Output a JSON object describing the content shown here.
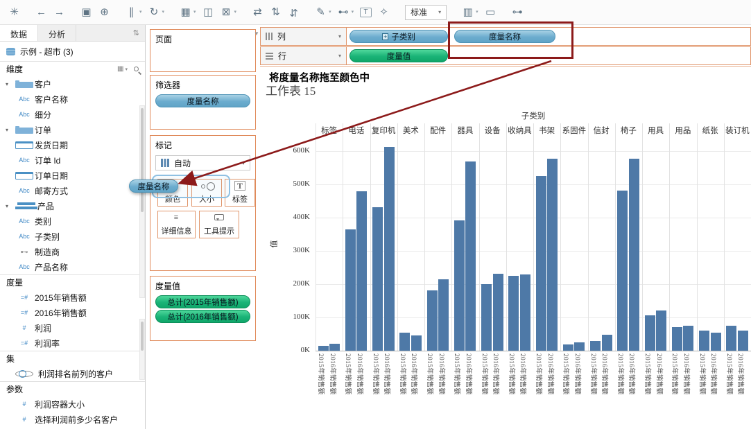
{
  "colors": {
    "bar_blue": "#4e79a7",
    "pill_dimension_teal": "#68abcd",
    "pill_measure_green": "#17b374",
    "annotation_red": "#8c1a1a",
    "highlight_border_orange": "#e08a5a"
  },
  "toolbar": {
    "items": [
      {
        "name": "tableau-logo",
        "glyph": "✳"
      },
      {
        "name": "undo",
        "glyph": "←",
        "gap": true
      },
      {
        "name": "redo",
        "glyph": "→"
      },
      {
        "name": "save",
        "glyph": "▣",
        "gap": true
      },
      {
        "name": "add-datasource",
        "glyph": "⊕"
      },
      {
        "name": "pause-updates",
        "glyph": "∥",
        "dropdown": true,
        "gap": true
      },
      {
        "name": "refresh",
        "glyph": "↻",
        "dropdown": true
      },
      {
        "name": "new-worksheet",
        "glyph": "▦",
        "dropdown": true,
        "gap": true
      },
      {
        "name": "duplicate-sheet",
        "glyph": "◫"
      },
      {
        "name": "clear-sheet",
        "glyph": "⊠",
        "dropdown": true
      },
      {
        "name": "swap-axes",
        "glyph": "⇄",
        "gap": true
      },
      {
        "name": "sort-ascending",
        "glyph": "⇅"
      },
      {
        "name": "sort-descending",
        "glyph": "⇅",
        "flip": true
      },
      {
        "name": "highlight",
        "glyph": "✎",
        "dropdown": true,
        "gap": true
      },
      {
        "name": "group-members",
        "glyph": "⊷",
        "dropdown": true
      },
      {
        "name": "text-label",
        "glyph": "T",
        "boxed": true
      },
      {
        "name": "fix-axes",
        "glyph": "✧"
      },
      {
        "name": "fit",
        "type": "select",
        "label": "标准",
        "dropdown": true,
        "gap": true
      },
      {
        "name": "show-mark-labels",
        "glyph": "▥",
        "dropdown": true,
        "gap": true
      },
      {
        "name": "presentation-mode",
        "glyph": "▭"
      },
      {
        "name": "share",
        "glyph": "⊶",
        "gap": true
      }
    ]
  },
  "left_panel": {
    "tabs": [
      {
        "label": "数据",
        "active": true
      },
      {
        "label": "分析",
        "active": false
      }
    ],
    "datasource": {
      "label": "示例 - 超市 (3)"
    },
    "dimensions": {
      "title": "维度",
      "items": [
        {
          "icon": "folder",
          "label": "客户",
          "level": 0,
          "caret": true
        },
        {
          "icon": "abc",
          "label": "客户名称",
          "level": 1
        },
        {
          "icon": "abc",
          "label": "细分",
          "level": 1
        },
        {
          "icon": "folder",
          "label": "订单",
          "level": 0,
          "caret": true
        },
        {
          "icon": "calendar",
          "label": "发货日期",
          "level": 1
        },
        {
          "icon": "abc",
          "label": "订单 Id",
          "level": 1
        },
        {
          "icon": "calendar",
          "label": "订单日期",
          "level": 1
        },
        {
          "icon": "abc",
          "label": "邮寄方式",
          "level": 1
        },
        {
          "icon": "hierarchy",
          "label": "产品",
          "level": 0,
          "caret": true
        },
        {
          "icon": "abc",
          "label": "类别",
          "level": 1
        },
        {
          "icon": "abc",
          "label": "子类别",
          "level": 1
        },
        {
          "icon": "paperclip",
          "label": "制造商",
          "level": 1
        },
        {
          "icon": "abc",
          "label": "产品名称",
          "level": 1
        }
      ]
    },
    "measures": {
      "title": "度量",
      "items": [
        {
          "icon": "calc",
          "label": "2015年销售额"
        },
        {
          "icon": "calc",
          "label": "2016年销售额"
        },
        {
          "icon": "number",
          "label": "利润"
        },
        {
          "icon": "calc",
          "label": "利润率"
        }
      ]
    },
    "sets": {
      "title": "集",
      "items": [
        {
          "icon": "venn",
          "label": "利润排名前列的客户"
        }
      ]
    },
    "parameters": {
      "title": "参数",
      "items": [
        {
          "icon": "number",
          "label": "利润容器大小"
        },
        {
          "icon": "number",
          "label": "选择利润前多少名客户"
        }
      ]
    }
  },
  "cards": {
    "pages": {
      "title": "页面"
    },
    "filters": {
      "title": "筛选器",
      "pills": [
        {
          "label": "度量名称",
          "type": "dimension"
        }
      ]
    },
    "marks": {
      "title": "标记",
      "type_selector": {
        "label": "自动"
      },
      "buttons": [
        {
          "icon": "color",
          "label": "颜色"
        },
        {
          "icon": "size",
          "label": "大小"
        },
        {
          "icon": "label",
          "label": "标签"
        },
        {
          "icon": "detail",
          "label": "详细信息"
        },
        {
          "icon": "tooltip",
          "label": "工具提示"
        }
      ]
    },
    "measure_values": {
      "title": "度量值",
      "pills": [
        {
          "label": "总计(2015年销售额)",
          "type": "measure"
        },
        {
          "label": "总计(2016年销售额)",
          "type": "measure"
        }
      ]
    },
    "drag_pill": {
      "label": "度量名称"
    }
  },
  "shelves": {
    "columns": {
      "label": "列",
      "pills": [
        {
          "label": "子类别",
          "type": "dimension",
          "prefix": "+"
        },
        {
          "label": "度量名称",
          "type": "dimension",
          "highlighted": true
        }
      ]
    },
    "rows": {
      "label": "行",
      "pills": [
        {
          "label": "度量值",
          "type": "measure"
        }
      ]
    }
  },
  "annotation": {
    "text": "将度量名称拖至颜色中"
  },
  "chart_data": {
    "type": "bar",
    "title": "工作表 15",
    "column_header": "子类别",
    "ylabel": "值",
    "yticks": [
      "0K",
      "100K",
      "200K",
      "300K",
      "400K",
      "500K",
      "600K"
    ],
    "ylim": [
      0,
      635
    ],
    "grid": true,
    "categories": [
      "标签",
      "电话",
      "复印机",
      "美术",
      "配件",
      "器具",
      "设备",
      "收纳具",
      "书架",
      "系固件",
      "信封",
      "椅子",
      "用具",
      "用品",
      "纸张",
      "装订机"
    ],
    "series": [
      {
        "name": "2015年销售额",
        "values": [
          15,
          365,
          432,
          55,
          182,
          392,
          200,
          226,
          525,
          18,
          30,
          482,
          106,
          70,
          60,
          76
        ]
      },
      {
        "name": "2016年销售额",
        "values": [
          21,
          480,
          612,
          46,
          215,
          568,
          232,
          230,
          578,
          26,
          47,
          578,
          120,
          74,
          54,
          60
        ]
      }
    ],
    "unit": "K"
  }
}
